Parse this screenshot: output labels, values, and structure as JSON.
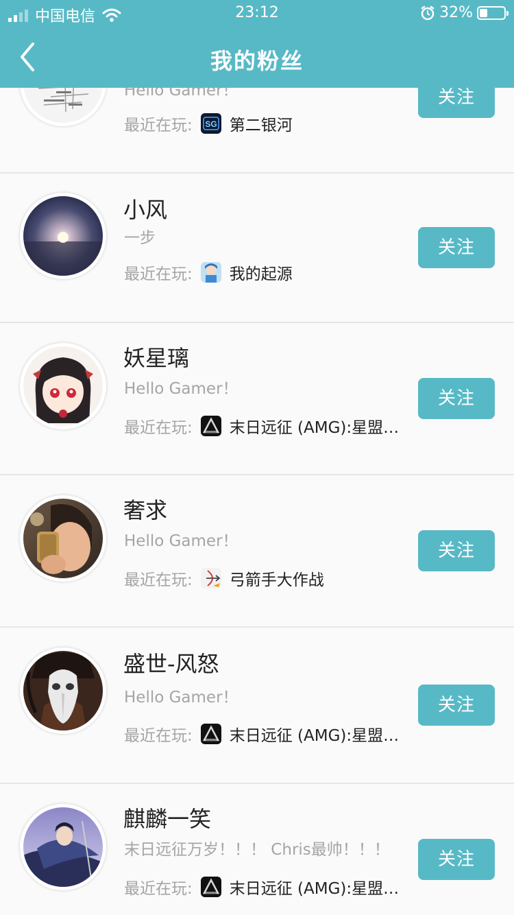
{
  "status_bar": {
    "carrier": "中国电信",
    "time": "23:12",
    "battery": "32%",
    "battery_level": 0.32
  },
  "nav": {
    "title": "我的粉丝",
    "back_icon": "chevron-left-icon"
  },
  "colors": {
    "accent": "#58b9c6",
    "text_primary": "#222222",
    "text_secondary": "#a5a5a5"
  },
  "fans": [
    {
      "name": "",
      "signature": "Hello Gamer！",
      "recent_label": "最近在玩:",
      "game": "第二银河",
      "game_icon": "second-galaxy-icon",
      "avatar": "text-sketch-avatar",
      "follow_label": "关注"
    },
    {
      "name": "小风",
      "signature": "一步",
      "recent_label": "最近在玩:",
      "game": "我的起源",
      "game_icon": "my-origin-icon",
      "avatar": "sky-light-avatar",
      "follow_label": "关注"
    },
    {
      "name": "妖星璃",
      "signature": "Hello Gamer！",
      "recent_label": "最近在玩:",
      "game": "末日远征 (AMG):星盟冲突",
      "game_icon": "amg-icon",
      "avatar": "anime-girl-avatar",
      "follow_label": "关注"
    },
    {
      "name": "奢求",
      "signature": "Hello Gamer！",
      "recent_label": "最近在玩:",
      "game": "弓箭手大作战",
      "game_icon": "archer-icon",
      "avatar": "selfie-avatar",
      "follow_label": "关注"
    },
    {
      "name": "盛世-风怒",
      "signature": "Hello Gamer！",
      "recent_label": "最近在玩:",
      "game": "末日远征 (AMG):星盟冲突",
      "game_icon": "amg-icon",
      "avatar": "plague-mask-avatar",
      "follow_label": "关注"
    },
    {
      "name": "麒麟一笑",
      "signature": "末日远征万岁！！！ Chris最帅！！！",
      "recent_label": "最近在玩:",
      "game": "末日远征 (AMG):星盟冲突",
      "game_icon": "amg-icon",
      "avatar": "warrior-avatar",
      "follow_label": "关注"
    }
  ]
}
